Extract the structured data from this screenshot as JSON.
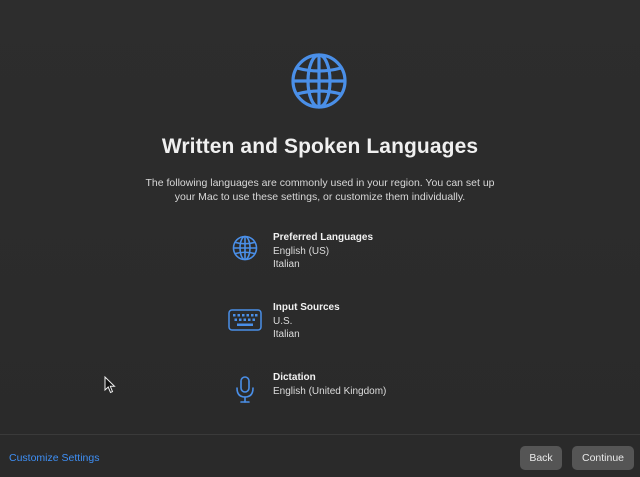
{
  "page": {
    "title": "Written and Spoken Languages",
    "description": "The following languages are commonly used in your region. You can set up your Mac to use these settings, or customize them individually."
  },
  "settings": [
    {
      "heading": "Preferred Languages",
      "values": [
        "English (US)",
        "Italian"
      ],
      "icon": "globe-icon"
    },
    {
      "heading": "Input Sources",
      "values": [
        "U.S.",
        "Italian"
      ],
      "icon": "keyboard-icon"
    },
    {
      "heading": "Dictation",
      "values": [
        "English (United Kingdom)"
      ],
      "icon": "microphone-icon"
    }
  ],
  "footer": {
    "customize_label": "Customize Settings",
    "back_label": "Back",
    "continue_label": "Continue"
  },
  "colors": {
    "accent": "#3e8ff5",
    "icon_blue": "#4a8fe8",
    "background": "#2b2b2b",
    "button": "#555555"
  }
}
